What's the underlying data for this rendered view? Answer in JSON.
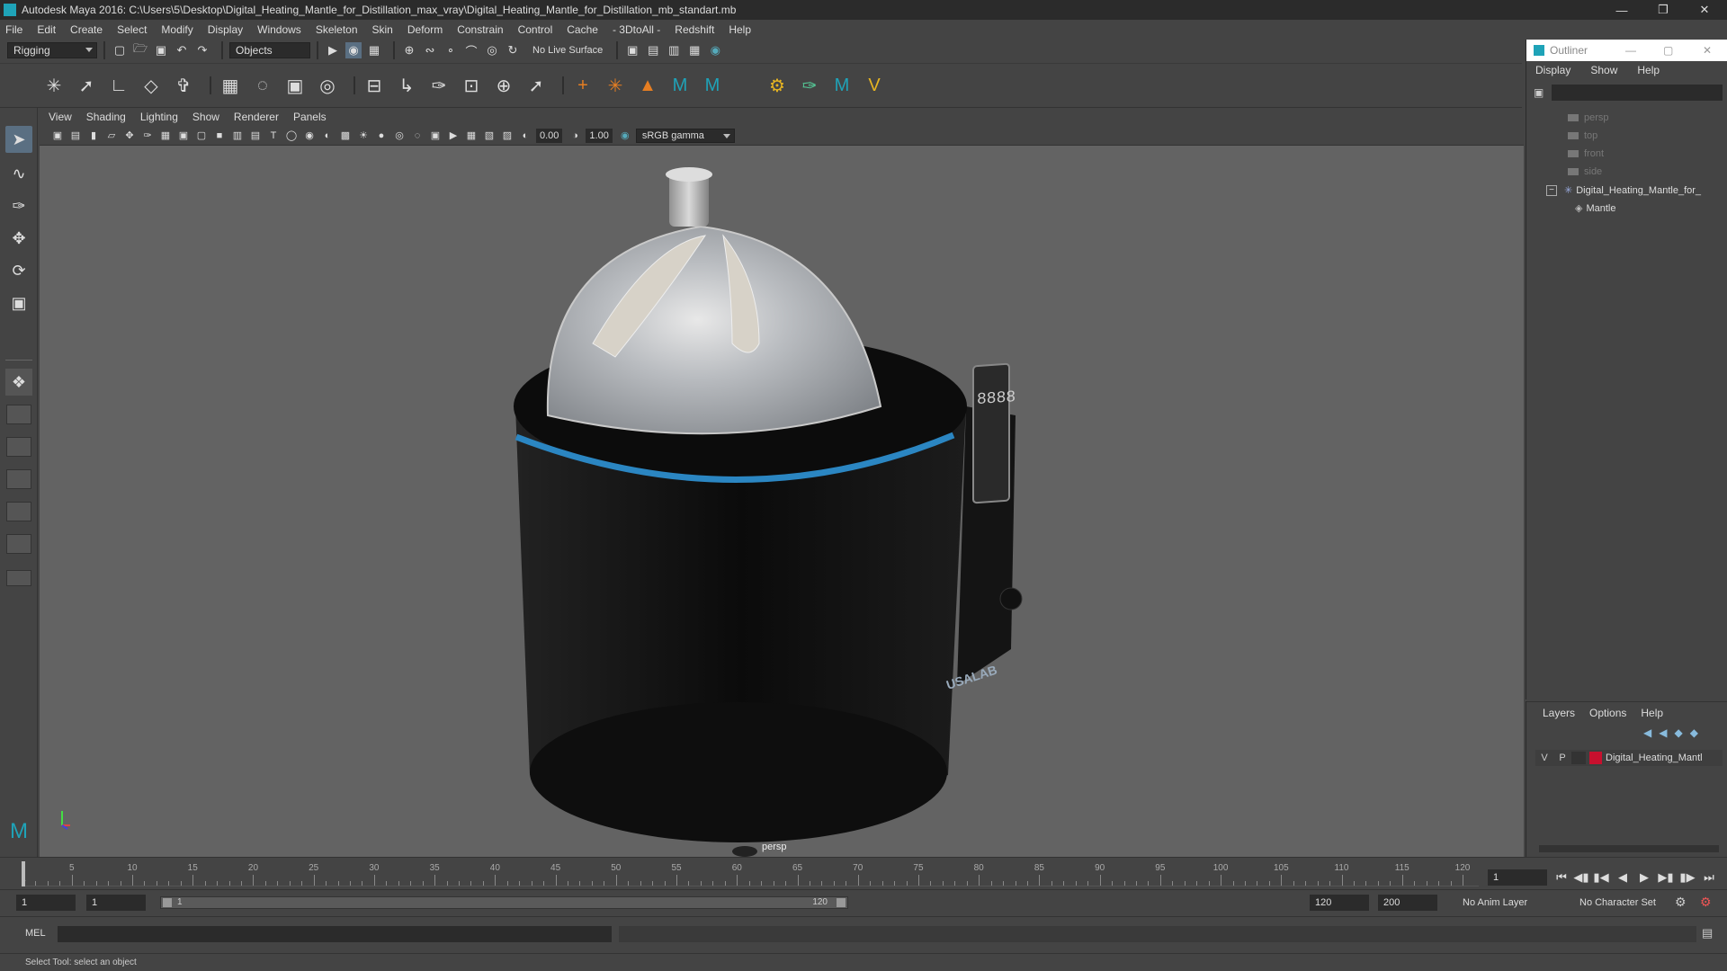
{
  "window": {
    "title": "Autodesk Maya 2016: C:\\Users\\5\\Desktop\\Digital_Heating_Mantle_for_Distillation_max_vray\\Digital_Heating_Mantle_for_Distillation_mb_standart.mb"
  },
  "menubar": [
    "File",
    "Edit",
    "Create",
    "Select",
    "Modify",
    "Display",
    "Windows",
    "Skeleton",
    "Skin",
    "Deform",
    "Constrain",
    "Control",
    "Cache",
    "- 3DtoAll -",
    "Redshift",
    "Help"
  ],
  "statusline": {
    "mode": "Rigging",
    "select_mode": "Objects",
    "live_surface": "No Live Surface"
  },
  "panel": {
    "menu": [
      "View",
      "Shading",
      "Lighting",
      "Show",
      "Renderer",
      "Panels"
    ],
    "exposure": "0.00",
    "gamma": "1.00",
    "color_space": "sRGB gamma",
    "camera_label": "persp"
  },
  "model": {
    "brand": "USALAB",
    "display": "8888"
  },
  "outliner": {
    "title": "Outliner",
    "menu": [
      "Display",
      "Show",
      "Help"
    ],
    "cameras": [
      "persp",
      "top",
      "front",
      "side"
    ],
    "group": "Digital_Heating_Mantle_for_",
    "child": "Mantle"
  },
  "layers": {
    "menu": [
      "Layers",
      "Options",
      "Help"
    ],
    "row": {
      "v": "V",
      "p": "P",
      "name": "Digital_Heating_Mantl",
      "color": "#c8102e"
    }
  },
  "timeline": {
    "labels": [
      "5",
      "10",
      "15",
      "20",
      "25",
      "30",
      "35",
      "40",
      "45",
      "50",
      "55",
      "60",
      "65",
      "70",
      "75",
      "80",
      "85",
      "90",
      "95",
      "100",
      "105",
      "110",
      "115",
      "120"
    ],
    "start_label": "1",
    "current_frame": "1"
  },
  "range": {
    "start": "1",
    "playback_start": "1",
    "slider_start": "1",
    "slider_end": "120",
    "playback_end": "120",
    "end": "200",
    "anim_layer": "No Anim Layer",
    "character_set": "No Character Set"
  },
  "cmdline": {
    "label": "MEL"
  },
  "help": {
    "text": "Select Tool: select an object"
  }
}
